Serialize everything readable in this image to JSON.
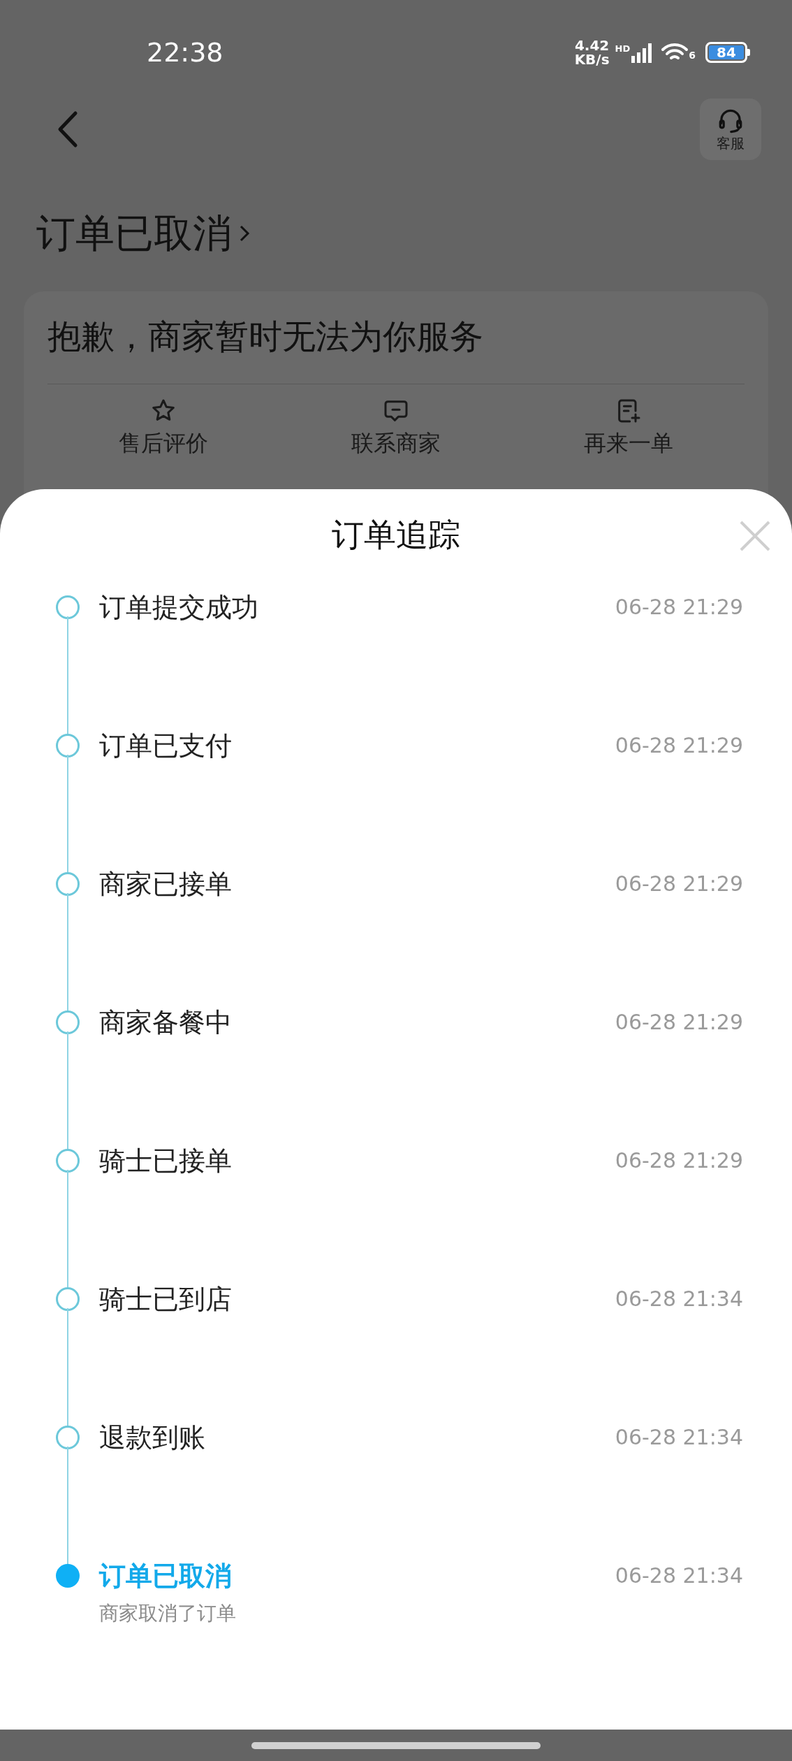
{
  "status_bar": {
    "time": "22:38",
    "net_speed_value": "4.42",
    "net_speed_unit": "KB/s",
    "signal_label": "HD",
    "wifi_label": "6",
    "battery": "84"
  },
  "header": {
    "service_label": "客服"
  },
  "order": {
    "status_title": "订单已取消",
    "message": "抱歉，商家暂时无法为你服务",
    "actions": [
      {
        "kind": "review",
        "label": "售后评价"
      },
      {
        "kind": "contact",
        "label": "联系商家"
      },
      {
        "kind": "reorder",
        "label": "再来一单"
      }
    ]
  },
  "tracking_sheet": {
    "title": "订单追踪",
    "steps": [
      {
        "label": "订单提交成功",
        "time": "06-28 21:29",
        "current": false
      },
      {
        "label": "订单已支付",
        "time": "06-28 21:29",
        "current": false
      },
      {
        "label": "商家已接单",
        "time": "06-28 21:29",
        "current": false
      },
      {
        "label": "商家备餐中",
        "time": "06-28 21:29",
        "current": false
      },
      {
        "label": "骑士已接单",
        "time": "06-28 21:29",
        "current": false
      },
      {
        "label": "骑士已到店",
        "time": "06-28 21:34",
        "current": false
      },
      {
        "label": "退款到账",
        "time": "06-28 21:34",
        "current": false
      },
      {
        "label": "订单已取消",
        "time": "06-28 21:34",
        "current": true,
        "note": "商家取消了订单"
      }
    ]
  }
}
